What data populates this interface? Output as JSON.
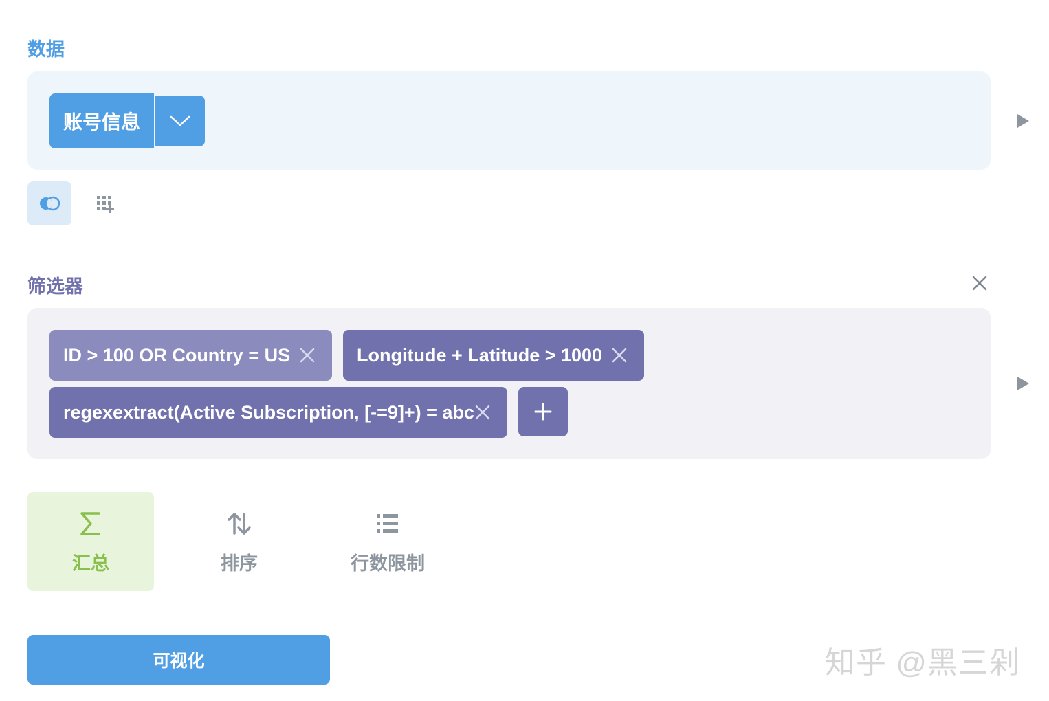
{
  "data_section": {
    "title": "数据",
    "table_name": "账号信息"
  },
  "filter_section": {
    "title": "筛选器",
    "filters": [
      {
        "label": "ID > 100 OR Country = US"
      },
      {
        "label": "Longitude + Latitude > 1000"
      },
      {
        "label": "regexextract(Active Subscription, [-=9]+) = abc"
      }
    ]
  },
  "actions": {
    "summarize_label": "汇总",
    "sort_label": "排序",
    "limit_label": "行数限制"
  },
  "visualize_label": "可视化",
  "watermark": "知乎 @黑三剁",
  "colors": {
    "data_blue": "#509ee3",
    "filter_purple": "#7172ad",
    "filter_purple_light": "#8b8bbd",
    "summarize_green": "#88bf4d",
    "muted_gray": "#8d959f"
  },
  "icons": {
    "table_dropdown": "chevron-down-icon",
    "run_step": "play-icon",
    "join": "join-icon",
    "custom_column": "custom-column-icon",
    "remove": "close-icon",
    "add": "plus-icon",
    "summarize": "sigma-icon",
    "sort": "sort-arrows-icon",
    "limit": "list-icon"
  }
}
